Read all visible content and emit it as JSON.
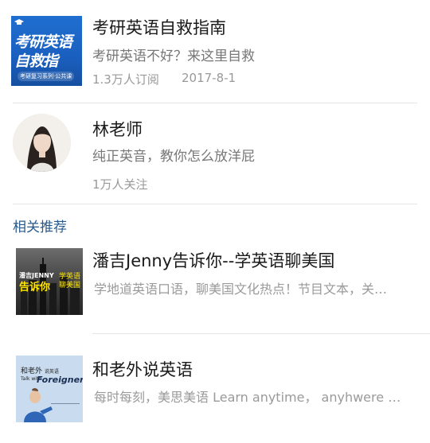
{
  "course": {
    "title": "考研英语自救指南",
    "desc": "考研英语不好？来这里自救",
    "subscribers": "1.3万人订阅",
    "date": "2017-8-1",
    "cover_line1": "考研英语",
    "cover_line2": "自救指",
    "cover_tag": "考研复习系列·公共课"
  },
  "teacher": {
    "name": "林老师",
    "desc": "纯正英音，教你怎么放洋屁",
    "followers": "1万人关注"
  },
  "related": {
    "heading": "相关推荐",
    "items": [
      {
        "title": "潘吉Jenny告诉你--学英语聊美国",
        "desc": "学地道英语口语，聊美国文化热点！节目文本，关…",
        "cover_text_top": "潘吉JENNY",
        "cover_text_main": "告诉你",
        "cover_text_side": "学英语\n聊美国"
      },
      {
        "title": "和老外说英语",
        "desc": "每时每刻，美思美语 Learn anytime， anyhwere 关…",
        "cover_text_cn": "和老外",
        "cover_text_cn_small": "说英语",
        "cover_text_talk": "Talk with",
        "cover_text_en": "Foreigners"
      }
    ]
  },
  "colors": {
    "cover_blue": "#1f6fd0",
    "section_heading": "#2a5a8a",
    "divider": "#e5e5e5"
  }
}
